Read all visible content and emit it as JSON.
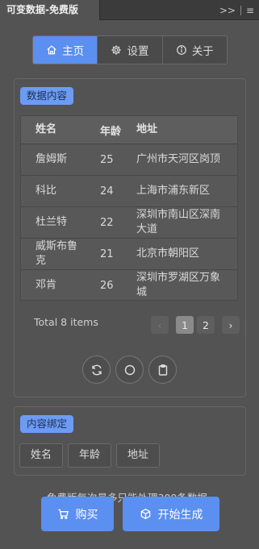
{
  "window": {
    "tab_title": "可变数据-免费版"
  },
  "nav": {
    "tabs": [
      "主页",
      "设置",
      "关于"
    ]
  },
  "data_panel": {
    "tag": "数据内容",
    "columns": [
      "姓名",
      "年龄",
      "地址"
    ],
    "rows": [
      [
        "詹姆斯",
        "25",
        "广州市天河区岗顶"
      ],
      [
        "科比",
        "24",
        "上海市浦东新区"
      ],
      [
        "杜兰特",
        "22",
        "深圳市南山区深南大道"
      ],
      [
        "威斯布鲁克",
        "21",
        "北京市朝阳区"
      ],
      [
        "邓肯",
        "26",
        "深圳市罗湖区万象城"
      ]
    ],
    "total": "Total 8 items",
    "pages": [
      "1",
      "2"
    ],
    "current_page": 1
  },
  "bind_panel": {
    "tag": "内容绑定",
    "fields": [
      "姓名",
      "年龄",
      "地址"
    ]
  },
  "footer": {
    "notice": "免费版每次最多只能处理300条数据",
    "buy_label": "购买",
    "generate_label": "开始生成"
  },
  "colors": {
    "accent": "#5b8ff0",
    "background": "#535353",
    "tag": "#6c9bf3"
  },
  "icons": [
    "collapse-icon",
    "menu-icon",
    "home-icon",
    "gear-icon",
    "info-icon",
    "refresh-icon",
    "circle-icon",
    "clipboard-icon",
    "cart-icon",
    "cube-icon"
  ]
}
